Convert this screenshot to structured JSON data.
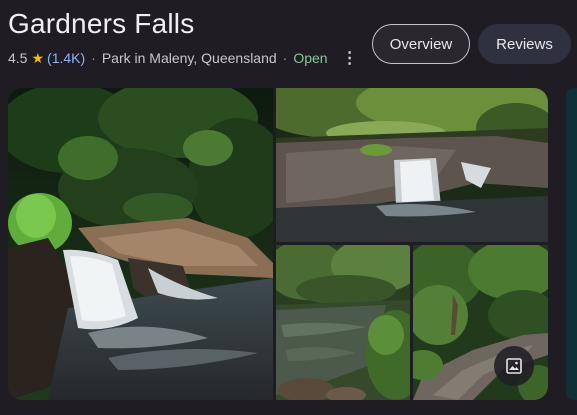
{
  "place": {
    "title": "Gardners Falls",
    "rating": "4.5",
    "review_count": "(1.4K)",
    "separator": "·",
    "category_location": "Park in Maleny, Queensland",
    "status": "Open"
  },
  "tabs": [
    {
      "label": "Overview",
      "selected": true
    },
    {
      "label": "Reviews",
      "selected": false
    }
  ],
  "icons": {
    "rating": "star-icon",
    "more": "more-vert-icon",
    "photos": "image-icon"
  },
  "colors": {
    "background": "#1f1c24",
    "rating_count": "#8ab4f8",
    "open_status": "#81c995",
    "star": "#fbbc04"
  }
}
